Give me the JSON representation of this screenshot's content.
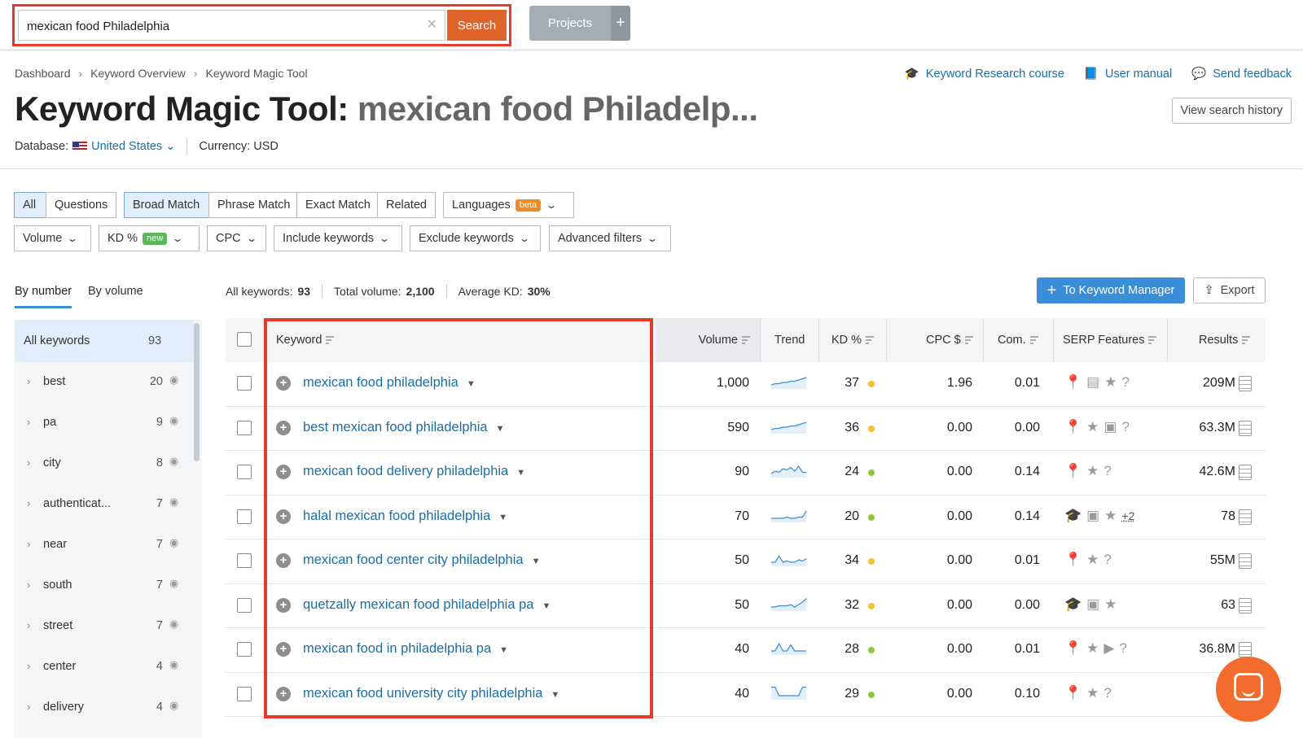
{
  "search": {
    "query": "mexican food Philadelphia",
    "button": "Search",
    "clear": "×"
  },
  "projects": {
    "label": "Projects",
    "plus": "+"
  },
  "breadcrumb": [
    "Dashboard",
    "Keyword Overview",
    "Keyword Magic Tool"
  ],
  "toplinks": [
    {
      "icon": "graduation-cap-icon",
      "glyph": "🎓",
      "label": "Keyword Research course"
    },
    {
      "icon": "book-icon",
      "glyph": "📘",
      "label": "User manual"
    },
    {
      "icon": "chat-icon",
      "glyph": "💬",
      "label": "Send feedback"
    }
  ],
  "title": {
    "main": "Keyword Magic Tool:",
    "query": "mexican food Philadelp..."
  },
  "view_history": "View search history",
  "database": {
    "label": "Database:",
    "country": "United States",
    "currency": "Currency: USD"
  },
  "filters1": [
    "All",
    "Questions",
    "Broad Match",
    "Phrase Match",
    "Exact Match",
    "Related"
  ],
  "languages": {
    "label": "Languages",
    "badge": "beta"
  },
  "filters2": {
    "volume": "Volume",
    "kd": "KD %",
    "kd_badge": "new",
    "cpc": "CPC",
    "include": "Include keywords",
    "exclude": "Exclude keywords",
    "advanced": "Advanced filters"
  },
  "tabs": {
    "by_number": "By number",
    "by_volume": "By volume"
  },
  "stats": {
    "all_label": "All keywords:",
    "all": "93",
    "vol_label": "Total volume:",
    "vol": "2,100",
    "kd_label": "Average KD:",
    "kd": "30%"
  },
  "to_manager": "To Keyword Manager",
  "export": "Export",
  "sidebar": {
    "all_label": "All keywords",
    "all_count": "93",
    "items": [
      {
        "label": "best",
        "count": "20"
      },
      {
        "label": "pa",
        "count": "9"
      },
      {
        "label": "city",
        "count": "8"
      },
      {
        "label": "authenticat...",
        "count": "7"
      },
      {
        "label": "near",
        "count": "7"
      },
      {
        "label": "south",
        "count": "7"
      },
      {
        "label": "street",
        "count": "7"
      },
      {
        "label": "center",
        "count": "4"
      },
      {
        "label": "delivery",
        "count": "4"
      }
    ]
  },
  "columns": {
    "keyword": "Keyword",
    "volume": "Volume",
    "trend": "Trend",
    "kd": "KD %",
    "cpc": "CPC $",
    "com": "Com.",
    "serp": "SERP Features",
    "results": "Results"
  },
  "colors": {
    "yellow": "#f5c02b",
    "green": "#8dc63f",
    "accent": "#3b8dd8",
    "brand": "#e0632a"
  },
  "rows": [
    {
      "keyword": "mexican food philadelphia",
      "volume": "1,000",
      "trend": [
        2,
        3,
        3,
        4,
        4,
        5,
        5,
        6,
        7,
        8
      ],
      "kd": "37",
      "kd_color": "yellow",
      "cpc": "1.96",
      "com": "0.01",
      "serp": "📍▤★?",
      "more": "",
      "results": "209M"
    },
    {
      "keyword": "best mexican food philadelphia",
      "volume": "590",
      "trend": [
        2,
        3,
        3,
        4,
        4,
        5,
        5,
        6,
        7,
        8
      ],
      "kd": "36",
      "kd_color": "yellow",
      "cpc": "0.00",
      "com": "0.00",
      "serp": "📍★▣?",
      "more": "",
      "results": "63.3M"
    },
    {
      "keyword": "mexican food delivery philadelphia",
      "volume": "90",
      "trend": [
        2,
        4,
        3,
        6,
        5,
        7,
        4,
        8,
        3,
        3
      ],
      "kd": "24",
      "kd_color": "green",
      "cpc": "0.00",
      "com": "0.14",
      "serp": "📍★?",
      "more": "",
      "results": "42.6M"
    },
    {
      "keyword": "halal mexican food philadelphia",
      "volume": "70",
      "trend": [
        2,
        2,
        2,
        2,
        3,
        2,
        2,
        3,
        3,
        8
      ],
      "kd": "20",
      "kd_color": "green",
      "cpc": "0.00",
      "com": "0.14",
      "serp": "🎓▣★",
      "more": "+2",
      "results": "78"
    },
    {
      "keyword": "mexican food center city philadelphia",
      "volume": "50",
      "trend": [
        2,
        2,
        7,
        2,
        3,
        2,
        2,
        4,
        3,
        5
      ],
      "kd": "34",
      "kd_color": "yellow",
      "cpc": "0.00",
      "com": "0.01",
      "serp": "📍★?",
      "more": "",
      "results": "55M"
    },
    {
      "keyword": "quetzally mexican food philadelphia pa",
      "volume": "50",
      "trend": [
        2,
        2,
        3,
        3,
        3,
        4,
        2,
        4,
        6,
        9
      ],
      "kd": "32",
      "kd_color": "yellow",
      "cpc": "0.00",
      "com": "0.00",
      "serp": "🎓▣★",
      "more": "",
      "results": "63"
    },
    {
      "keyword": "mexican food in philadelphia pa",
      "volume": "40",
      "trend": [
        2,
        2,
        8,
        2,
        2,
        7,
        2,
        2,
        2,
        2
      ],
      "kd": "28",
      "kd_color": "green",
      "cpc": "0.00",
      "com": "0.01",
      "serp": "📍★▶?",
      "more": "",
      "results": "36.8M"
    },
    {
      "keyword": "mexican food university city philadelphia",
      "volume": "40",
      "trend": [
        9,
        9,
        2,
        2,
        2,
        2,
        2,
        2,
        9,
        9
      ],
      "kd": "29",
      "kd_color": "green",
      "cpc": "0.00",
      "com": "0.10",
      "serp": "📍★?",
      "more": "",
      "results": ""
    }
  ]
}
